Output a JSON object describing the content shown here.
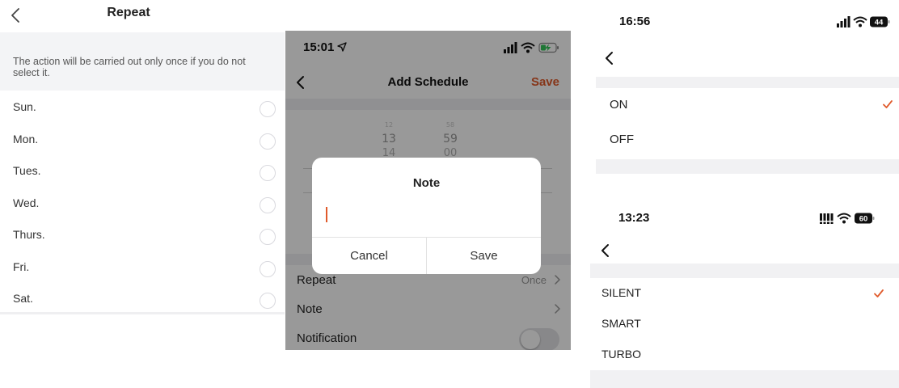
{
  "colors": {
    "accent": "#e05a2b",
    "hint_background": "#f3f4f6",
    "modal_dim": "rgba(0,0,0,0.40)"
  },
  "repeat_screen": {
    "title": "Repeat",
    "back_icon": "chevron-left-icon",
    "hint": "The action will be carried out only once if you do not select it.",
    "days": [
      {
        "label": "Sun.",
        "selected": false
      },
      {
        "label": "Mon.",
        "selected": false
      },
      {
        "label": "Tues.",
        "selected": false
      },
      {
        "label": "Wed.",
        "selected": false
      },
      {
        "label": "Thurs.",
        "selected": false
      },
      {
        "label": "Fri.",
        "selected": false
      },
      {
        "label": "Sat.",
        "selected": false
      }
    ]
  },
  "schedule_screen": {
    "status_time": "15:01",
    "status_icons": [
      "location-arrow-icon",
      "signal-icon",
      "wifi-icon",
      "battery-charging-icon"
    ],
    "title": "Add Schedule",
    "save_label": "Save",
    "time_picker": {
      "hours": [
        "12",
        "13",
        "14"
      ],
      "minutes": [
        "58",
        "59",
        "00"
      ]
    },
    "rows": [
      {
        "label": "Repeat",
        "value": "Once"
      },
      {
        "label": "Note",
        "value": ""
      },
      {
        "label": "Notification",
        "toggle": false
      }
    ],
    "note_dialog": {
      "title": "Note",
      "input_value": "",
      "cancel_label": "Cancel",
      "save_label": "Save"
    }
  },
  "power_screen": {
    "status_time": "16:56",
    "battery": "44",
    "options": [
      {
        "label": "ON",
        "checked": true
      },
      {
        "label": "OFF",
        "checked": false
      }
    ]
  },
  "mode_screen": {
    "status_time": "13:23",
    "battery": "60",
    "options": [
      {
        "label": "SILENT",
        "checked": true
      },
      {
        "label": "SMART",
        "checked": false
      },
      {
        "label": "TURBO",
        "checked": false
      }
    ]
  }
}
